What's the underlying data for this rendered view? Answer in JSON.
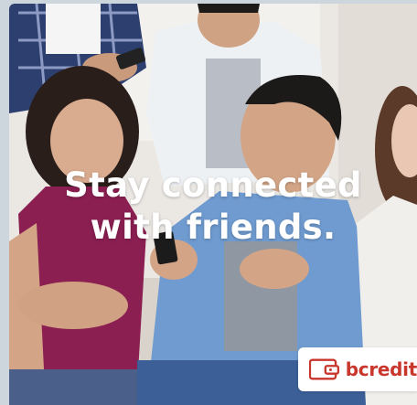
{
  "ad": {
    "headline_line1": "Stay connected",
    "headline_line2": "with friends.",
    "brand_name": "bcredit",
    "brand_color": "#c8362c",
    "photo_description_icon": "group-photo"
  }
}
